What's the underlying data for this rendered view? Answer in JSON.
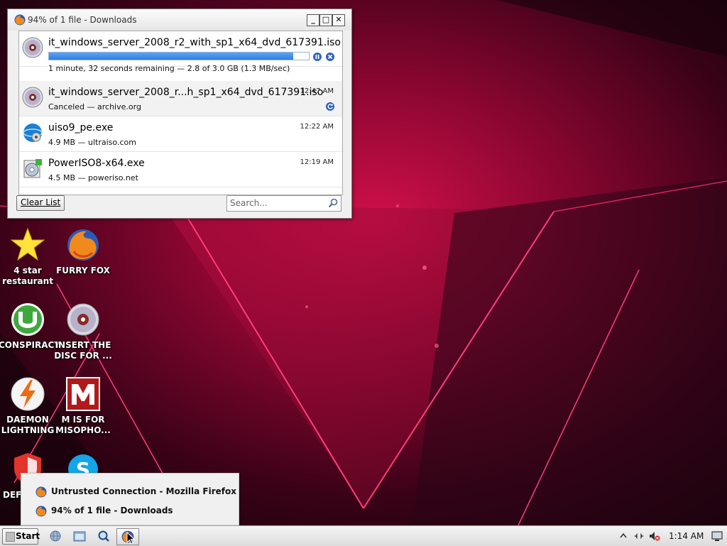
{
  "downloads_window": {
    "title": "94% of 1 file - Downloads",
    "controls": {
      "minimize": "_",
      "maximize": "□",
      "close": "✕"
    },
    "items": [
      {
        "name": "it_windows_server_2008_r2_with_sp1_x64_dvd_617391.iso",
        "status": "1 minute, 32 seconds remaining — 2.8 of 3.0 GB (1.3 MB/sec)",
        "time": "",
        "progress": 0.94,
        "icon": "disc-icon",
        "in_progress": true
      },
      {
        "name": "it_windows_server_2008_r...h_sp1_x64_dvd_617391.iso",
        "status": "Canceled — archive.org",
        "time": "12:47 AM",
        "icon": "disc-icon",
        "in_progress": false
      },
      {
        "name": "uiso9_pe.exe",
        "status": "4.9 MB — ultraiso.com",
        "time": "12:22 AM",
        "icon": "ultraiso-icon",
        "in_progress": false
      },
      {
        "name": "PowerISO8-x64.exe",
        "status": "4.5 MB — poweriso.net",
        "time": "12:19 AM",
        "icon": "poweriso-icon",
        "in_progress": false
      }
    ],
    "clear_list_label": "Clear List",
    "search_placeholder": "Search..."
  },
  "desktop_icons": [
    {
      "label": "4 star restaurant",
      "icon": "star-icon"
    },
    {
      "label": "FURRY FOX",
      "icon": "firefox-icon"
    },
    {
      "label": "CONSPIRACY",
      "icon": "utorrent-icon"
    },
    {
      "label": "INSERT THE DISC FOR ...",
      "icon": "disc-icon"
    },
    {
      "label": "DAEMON LIGHTNING",
      "icon": "daemon-tools-icon"
    },
    {
      "label": "M IS FOR MISOPHO...",
      "icon": "malwarebytes-icon"
    },
    {
      "label": "DEF",
      "icon": "defender-shield-icon"
    },
    {
      "label": "",
      "icon": "skype-icon"
    }
  ],
  "taskbar_popup": {
    "items": [
      {
        "label": "Untrusted Connection - Mozilla Firefox",
        "icon": "firefox-icon"
      },
      {
        "label": "94% of 1 file - Downloads",
        "icon": "firefox-icon"
      }
    ]
  },
  "taskbar": {
    "start_label": "Start",
    "clock": "1:14 AM",
    "tray_icons": [
      "show-hidden-icons-arrow",
      "network-icon",
      "volume-muted-icon",
      "monitor-icon"
    ]
  },
  "colors": {
    "progress_fill": "#2f7ee6",
    "wallpaper_accent": "#ff2a6a",
    "window_bg": "#f0f0f0"
  }
}
